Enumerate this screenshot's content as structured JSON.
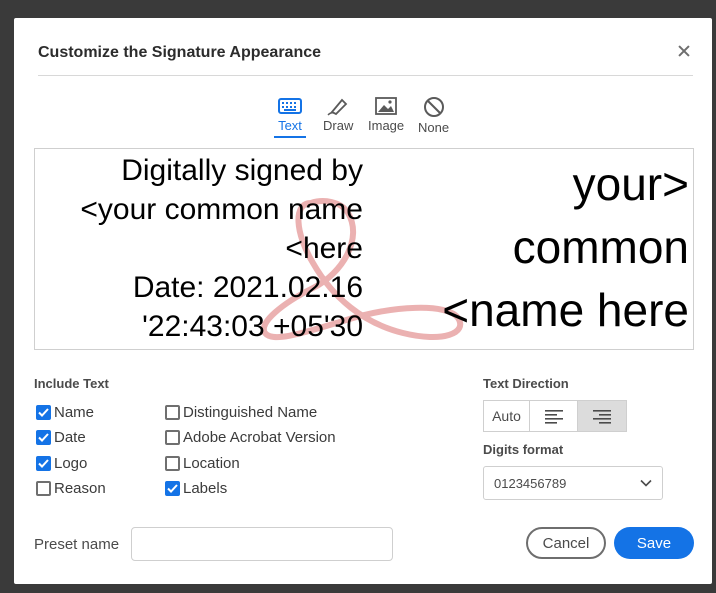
{
  "dialog": {
    "title": "Customize the Signature Appearance"
  },
  "tabs": [
    {
      "label": "Text",
      "icon": "keyboard-icon",
      "active": true
    },
    {
      "label": "Draw",
      "icon": "pen-icon",
      "active": false
    },
    {
      "label": "Image",
      "icon": "image-icon",
      "active": false
    },
    {
      "label": "None",
      "icon": "none-icon",
      "active": false
    }
  ],
  "preview": {
    "left_lines": [
      "Digitally signed by",
      "<your common name",
      "<here",
      "Date: 2021.02.16",
      "'22:43:03 +05'30"
    ],
    "right_lines": [
      "your>",
      "common",
      "<name here"
    ],
    "logo": "adobe-acrobat-logo-watermark"
  },
  "include_text": {
    "label": "Include Text",
    "items": [
      {
        "label": "Name",
        "checked": true
      },
      {
        "label": "Date",
        "checked": true
      },
      {
        "label": "Logo",
        "checked": true
      },
      {
        "label": "Reason",
        "checked": false
      },
      {
        "label": "Distinguished Name",
        "checked": false
      },
      {
        "label": "Adobe Acrobat Version",
        "checked": false
      },
      {
        "label": "Location",
        "checked": false
      },
      {
        "label": "Labels",
        "checked": true
      }
    ]
  },
  "text_direction": {
    "label": "Text Direction",
    "auto_label": "Auto",
    "selected": "right-aligned"
  },
  "digits_format": {
    "label": "Digits format",
    "value": "0123456789"
  },
  "preset": {
    "label": "Preset name",
    "value": ""
  },
  "buttons": {
    "cancel": "Cancel",
    "save": "Save"
  },
  "colors": {
    "accent": "#1473e6",
    "logo_watermark": "#e8a3a3"
  }
}
